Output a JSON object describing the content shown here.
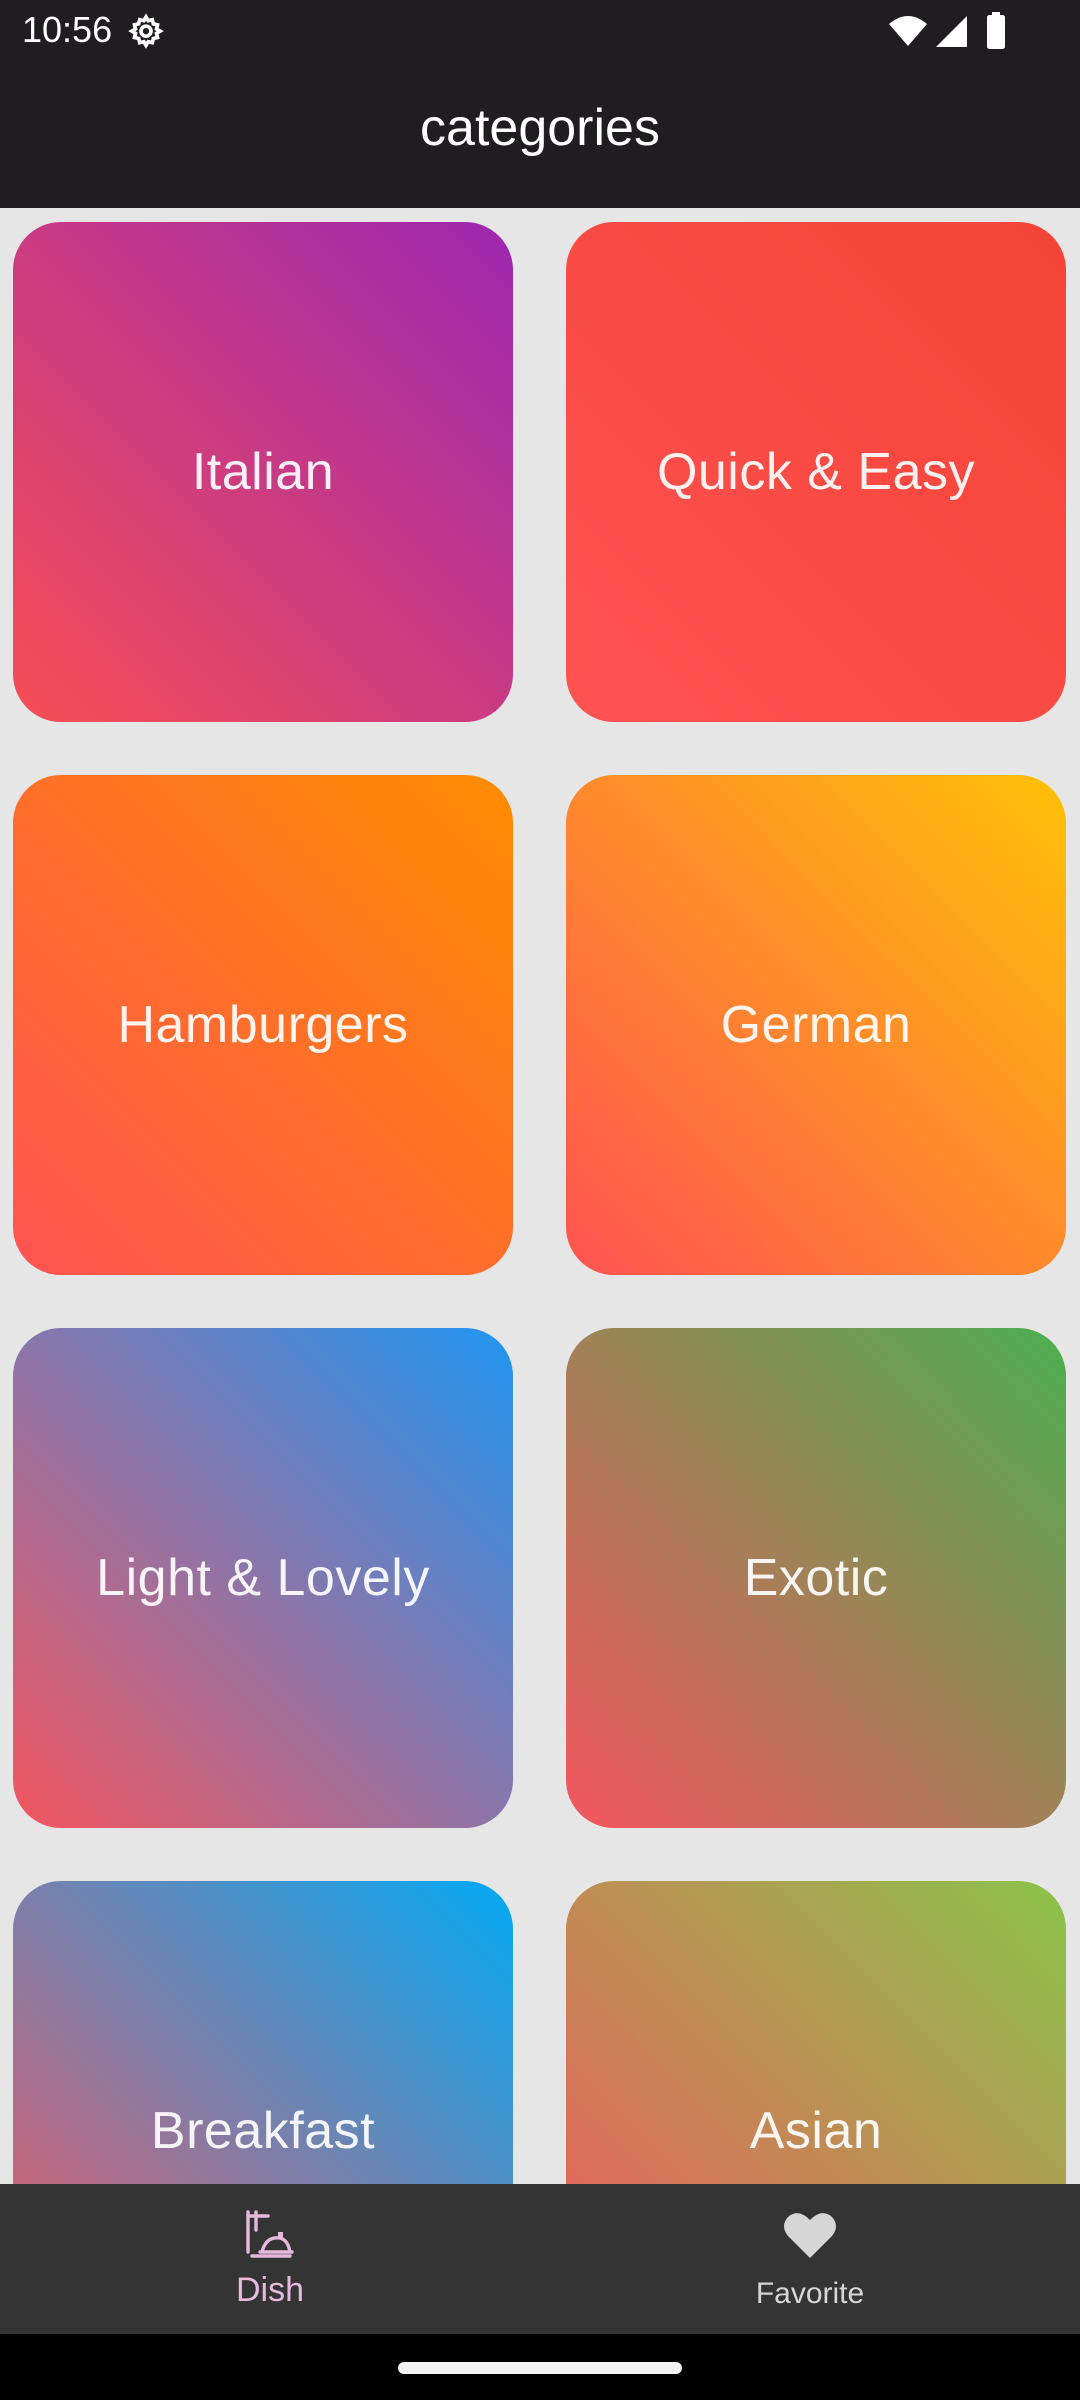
{
  "status_bar": {
    "time": "10:56",
    "icons": [
      "settings-gear-icon",
      "wifi-icon",
      "signal-icon",
      "battery-icon"
    ]
  },
  "app_bar": {
    "title": "categories",
    "background": "#201d20"
  },
  "categories": [
    {
      "label": "Italian",
      "gradient": [
        "#f74e55",
        "#9c27b0"
      ]
    },
    {
      "label": "Quick & Easy",
      "gradient": [
        "#ff5252",
        "#f44336"
      ]
    },
    {
      "label": "Hamburgers",
      "gradient": [
        "#ff5252",
        "#ff8c00"
      ]
    },
    {
      "label": "German",
      "gradient": [
        "#ff5252",
        "#ffc107"
      ]
    },
    {
      "label": "Light & Lovely",
      "gradient": [
        "#f4555f",
        "#2196f3"
      ]
    },
    {
      "label": "Exotic",
      "gradient": [
        "#f4555f",
        "#4caf50"
      ]
    },
    {
      "label": "Breakfast",
      "gradient": [
        "#f4555f",
        "#03a9f4"
      ]
    },
    {
      "label": "Asian",
      "gradient": [
        "#f4555f",
        "#8bc34a"
      ]
    }
  ],
  "bottom_nav": {
    "items": [
      {
        "label": "Dish",
        "icon": "dish-icon",
        "selected": true,
        "color": "#e7b9df"
      },
      {
        "label": "Favorite",
        "icon": "heart-icon",
        "selected": false,
        "color": "#d6d6d6"
      }
    ]
  },
  "colors": {
    "grid_background": "#e6e6e6",
    "bottom_nav_background": "#343434"
  }
}
